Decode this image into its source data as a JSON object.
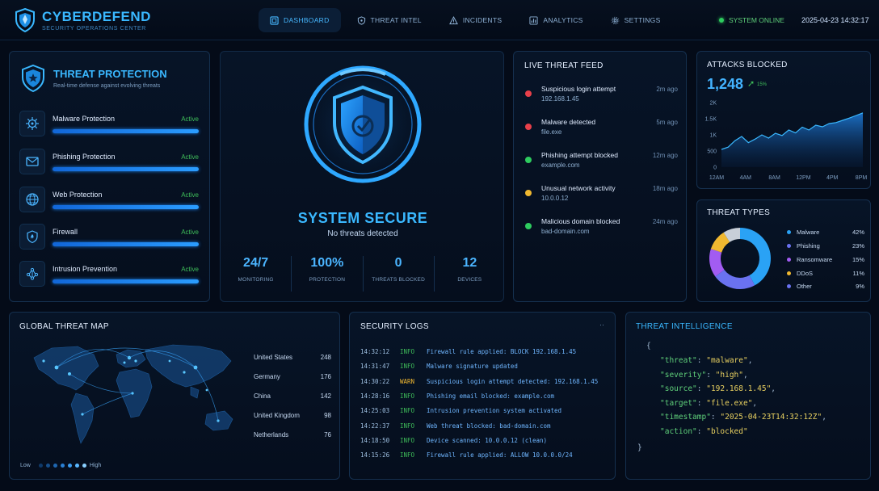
{
  "header": {
    "title": "CYBERDEFEND",
    "subtitle": "SECURITY OPERATIONS CENTER",
    "nav": [
      {
        "label": "DASHBOARD",
        "icon": "dashboard-icon",
        "active": true
      },
      {
        "label": "THREAT INTEL",
        "icon": "shield-outline-icon",
        "active": false
      },
      {
        "label": "INCIDENTS",
        "icon": "warning-triangle-icon",
        "active": false
      },
      {
        "label": "ANALYTICS",
        "icon": "bar-chart-icon",
        "active": false
      },
      {
        "label": "SETTINGS",
        "icon": "gear-icon",
        "active": false
      }
    ],
    "status": "SYSTEM ONLINE",
    "datetime": "2025-04-23 14:32:17"
  },
  "threat_protection": {
    "title": "THREAT PROTECTION",
    "subtitle": "Real-time defense against evolving threats",
    "items": [
      {
        "name": "Malware Protection",
        "state": "Active",
        "icon": "virus-icon",
        "level": 1.0
      },
      {
        "name": "Phishing Protection",
        "state": "Active",
        "icon": "envelope-icon",
        "level": 1.0
      },
      {
        "name": "Web Protection",
        "state": "Active",
        "icon": "globe-icon",
        "level": 1.0
      },
      {
        "name": "Firewall",
        "state": "Active",
        "icon": "firewall-shield-icon",
        "level": 1.0
      },
      {
        "name": "Intrusion Prevention",
        "state": "Active",
        "icon": "network-nodes-icon",
        "level": 1.0
      }
    ]
  },
  "system": {
    "title": "SYSTEM SECURE",
    "subtitle": "No threats detected",
    "stats": [
      {
        "value": "24/7",
        "label": "MONITORING"
      },
      {
        "value": "100%",
        "label": "PROTECTION"
      },
      {
        "value": "0",
        "label": "THREATS BLOCKED"
      },
      {
        "value": "12",
        "label": "DEVICES"
      }
    ]
  },
  "feed": {
    "title": "LIVE THREAT FEED",
    "items": [
      {
        "title": "Suspicious login attempt",
        "detail": "192.168.1.45",
        "time": "2m ago",
        "color": "#e8404a"
      },
      {
        "title": "Malware detected",
        "detail": "file.exe",
        "time": "5m ago",
        "color": "#e8404a"
      },
      {
        "title": "Phishing attempt blocked",
        "detail": "example.com",
        "time": "12m ago",
        "color": "#2ecc5f"
      },
      {
        "title": "Unusual network activity",
        "detail": "10.0.0.12",
        "time": "18m ago",
        "color": "#f0b830"
      },
      {
        "title": "Malicious domain blocked",
        "detail": "bad-domain.com",
        "time": "24m ago",
        "color": "#2ecc5f"
      }
    ]
  },
  "attacks": {
    "title": "ATTACKS BLOCKED",
    "value": "1,248",
    "change": "15%",
    "chart_data": {
      "type": "area",
      "x": [
        "12AM",
        "4AM",
        "8AM",
        "12PM",
        "4PM",
        "8PM"
      ],
      "y": [
        550,
        620,
        820,
        950,
        760,
        870,
        1000,
        900,
        1050,
        980,
        1150,
        1060,
        1240,
        1150,
        1300,
        1250,
        1350,
        1380,
        1450,
        1520,
        1600,
        1680
      ],
      "ytick_labels": [
        "2K",
        "1.5K",
        "1K",
        "500",
        "0"
      ],
      "ylim": [
        0,
        2000
      ]
    }
  },
  "threat_types": {
    "title": "THREAT TYPES",
    "chart_data": {
      "type": "pie",
      "labels": [
        "Malware",
        "Phishing",
        "Ransomware",
        "DDoS",
        "Other"
      ],
      "values": [
        42,
        23,
        15,
        11,
        9
      ],
      "pct_labels": [
        "42%",
        "23%",
        "15%",
        "11%",
        "9%"
      ],
      "colors": [
        "#2aa2f5",
        "#6a72f0",
        "#a25cf2",
        "#f0b830",
        "#c8cfd8"
      ]
    }
  },
  "map": {
    "title": "GLOBAL THREAT MAP",
    "countries": [
      {
        "name": "United States",
        "count": "248"
      },
      {
        "name": "Germany",
        "count": "176"
      },
      {
        "name": "China",
        "count": "142"
      },
      {
        "name": "United Kingdom",
        "count": "98"
      },
      {
        "name": "Netherlands",
        "count": "76"
      }
    ],
    "legend_low": "Low",
    "legend_high": "High"
  },
  "logs": {
    "title": "SECURITY LOGS",
    "more": "··",
    "entries": [
      {
        "time": "14:32:12",
        "level": "INFO",
        "msg": "Firewall rule applied: BLOCK 192.168.1.45"
      },
      {
        "time": "14:31:47",
        "level": "INFO",
        "msg": "Malware signature updated"
      },
      {
        "time": "14:30:22",
        "level": "WARN",
        "msg": "Suspicious login attempt detected: 192.168.1.45"
      },
      {
        "time": "14:28:16",
        "level": "INFO",
        "msg": "Phishing email blocked: example.com"
      },
      {
        "time": "14:25:03",
        "level": "INFO",
        "msg": "Intrusion prevention system activated"
      },
      {
        "time": "14:22:37",
        "level": "INFO",
        "msg": "Web threat blocked: bad-domain.com"
      },
      {
        "time": "14:18:50",
        "level": "INFO",
        "msg": "Device scanned: 10.0.0.12 (clean)"
      },
      {
        "time": "14:15:26",
        "level": "INFO",
        "msg": "Firewall rule applied: ALLOW 10.0.0.0/24"
      }
    ]
  },
  "intel": {
    "title": "THREAT INTELLIGENCE",
    "open": "{",
    "close": "}",
    "pairs": [
      {
        "key": "\"threat\"",
        "value": "\"malware\""
      },
      {
        "key": "\"severity\"",
        "value": "\"high\""
      },
      {
        "key": "\"source\"",
        "value": "\"192.168.1.45\""
      },
      {
        "key": "\"target\"",
        "value": "\"file.exe\""
      },
      {
        "key": "\"timestamp\"",
        "value": "\"2025-04-23T14:32:12Z\""
      },
      {
        "key": "\"action\"",
        "value": "\"blocked\""
      }
    ]
  }
}
